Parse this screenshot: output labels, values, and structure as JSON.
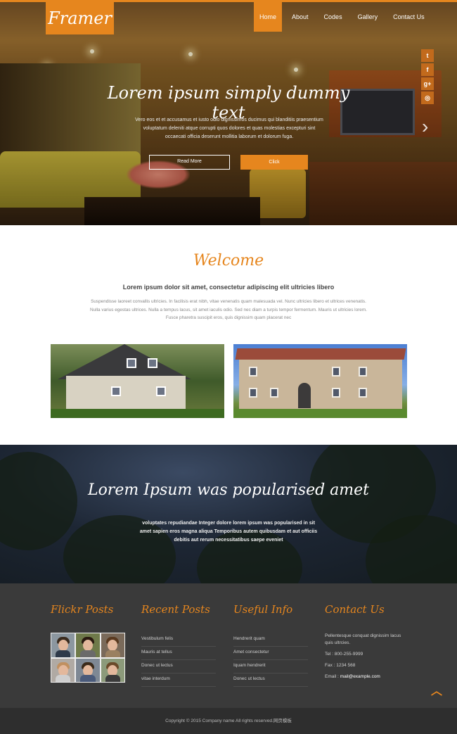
{
  "brand": {
    "logo": "Framer",
    "accent": "#e6861e"
  },
  "nav": {
    "items": [
      "Home",
      "About",
      "Codes",
      "Gallery",
      "Contact Us"
    ],
    "active": "Home"
  },
  "social": [
    "twitter-icon",
    "facebook-icon",
    "google-plus-icon",
    "dribbble-icon"
  ],
  "hero": {
    "title": "Lorem ipsum simply dummy text",
    "subtitle": "Vero eos et et accusamus et iusto odio dignissimos ducimus qui blanditiis praesentium voluptatum deleniti atque corrupti quos dolores et quas molestias excepturi sint occaecati officia deserunt mollitia laborum et dolorum fuga.",
    "read_more": "Read More",
    "click": "Click"
  },
  "welcome": {
    "title": "Welcome",
    "lead": "Lorem ipsum dolor sit amet, consectetur adipiscing elit ultricies libero",
    "body": "Suspendisse laoreet convallis ultricies. In facilisis erat nibh, vitae venenatis quam malesuada vel. Nunc ultricies libero et ultrices venenatis. Nulla varius egestas ultrices. Nulla a tempus lacus, sit amet iaculis odio. Sed nec diam a turpis tempor fermentum. Mauris ut ultricies lorem. Fusce pharetra suscipit eros, quis dignissim quam placerat nec"
  },
  "banner": {
    "title": "Lorem Ipsum was popularised amet",
    "text": "voluptates repudiandae Integer dolore lorem ipsum was popularised in sit amet sapien eros magna aliqua Temporibus autem quibusdam et aut officiis debitis aut rerum necessitatibus saepe eveniet"
  },
  "footer": {
    "flickr_title": "Flickr Posts",
    "recent_title": "Recent Posts",
    "recent_items": [
      "Vestibulum felis",
      "Mauris at tellus",
      "Donec ut lectus",
      "vitae interdum"
    ],
    "useful_title": "Useful Info",
    "useful_items": [
      "Hendrerit quam",
      "Amet consectetur",
      "Iquam hendrerit",
      "Donec ut lectus"
    ],
    "contact_title": "Contact Us",
    "contact_text": "Pellentesque conquat dignissim lacus quis ultrcies.",
    "tel": "Tel : 800-255-9999",
    "fax": "Fax : 1234 568",
    "email_label": "Email : ",
    "email": "mail@example.com"
  },
  "copyright": "Copyright © 2015 Company name All rights reserved.网页模板"
}
